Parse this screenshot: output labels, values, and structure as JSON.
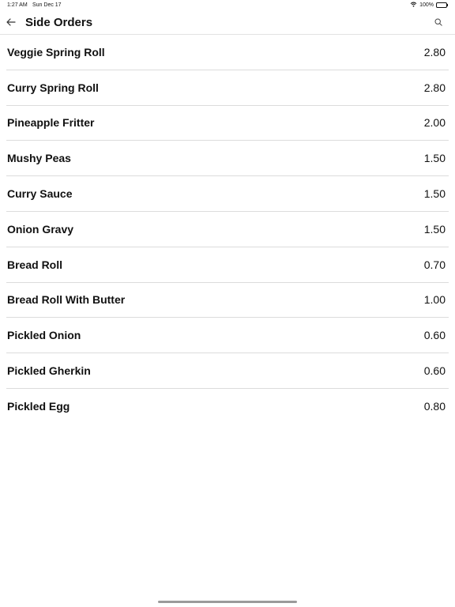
{
  "status_bar": {
    "time": "1:27 AM",
    "date": "Sun Dec 17",
    "battery_text": "100%",
    "icons": [
      "wifi-icon",
      "battery-icon"
    ]
  },
  "header": {
    "title": "Side Orders",
    "back_icon": "arrow-left-icon",
    "search_icon": "search-icon"
  },
  "items": [
    {
      "name": "Veggie Spring Roll",
      "price": "2.80"
    },
    {
      "name": "Curry Spring Roll",
      "price": "2.80"
    },
    {
      "name": "Pineapple Fritter",
      "price": "2.00"
    },
    {
      "name": "Mushy Peas",
      "price": "1.50"
    },
    {
      "name": "Curry Sauce",
      "price": "1.50"
    },
    {
      "name": "Onion Gravy",
      "price": "1.50"
    },
    {
      "name": "Bread Roll",
      "price": "0.70"
    },
    {
      "name": "Bread Roll With Butter",
      "price": "1.00"
    },
    {
      "name": "Pickled Onion",
      "price": "0.60"
    },
    {
      "name": "Pickled Gherkin",
      "price": "0.60"
    },
    {
      "name": "Pickled Egg",
      "price": "0.80"
    }
  ]
}
